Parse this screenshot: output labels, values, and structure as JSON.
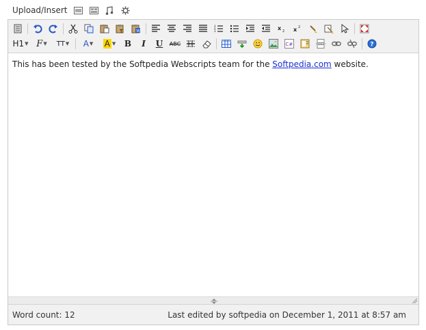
{
  "upload": {
    "label": "Upload/Insert",
    "icons": [
      "image-icon",
      "gallery-icon",
      "music-icon",
      "gear-icon"
    ]
  },
  "toolbar": {
    "format_heading": "H1",
    "font_family": "F",
    "font_size": "TT",
    "text_color": "A",
    "highlight": "A",
    "bold": "B",
    "italic": "I",
    "underline": "U",
    "strike": "ABC"
  },
  "content": {
    "before_link": "This has been tested by the Softpedia Webscripts team for the ",
    "link_text": "Softpedia.com",
    "after_link": " website."
  },
  "status": {
    "word_count": "Word count: 12",
    "last_edited": "Last edited by softpedia on December 1, 2011 at 8:57 am"
  },
  "colors": {
    "link": "#1b2fd1",
    "toolbar_bg": "#f1f1f1",
    "border": "#c9c9c9"
  }
}
